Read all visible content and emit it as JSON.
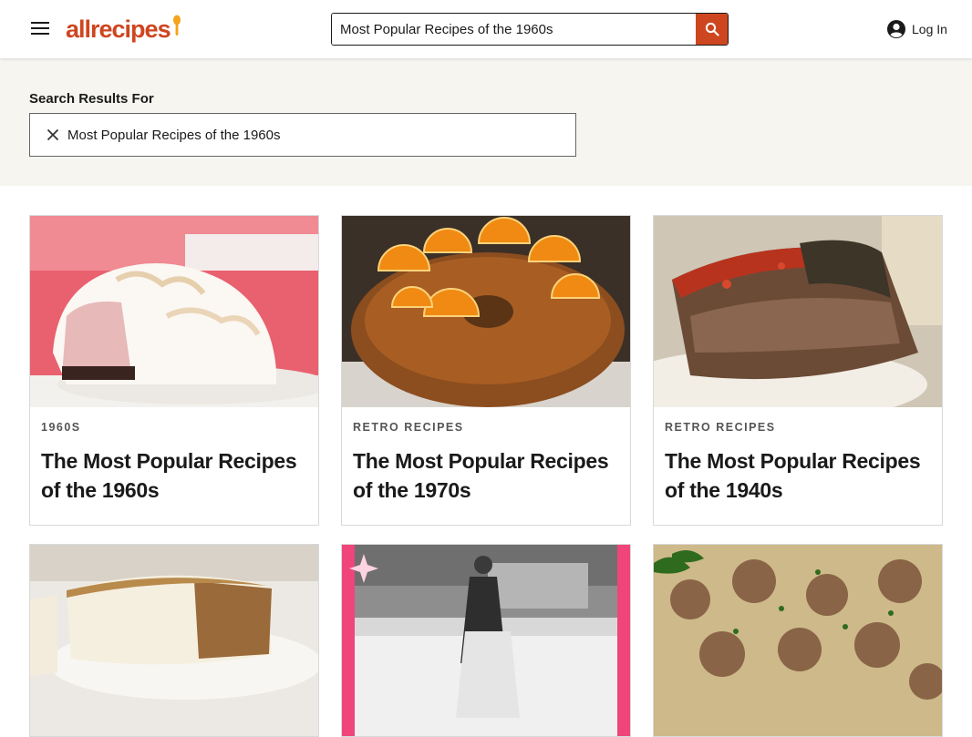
{
  "header": {
    "logo_text": "allrecipes",
    "search_value": "Most Popular Recipes of the 1960s",
    "login_label": "Log In",
    "brand_color": "#ce4620"
  },
  "results": {
    "title": "Search Results For",
    "query": "Most Popular Recipes of the 1960s"
  },
  "cards": [
    {
      "tag": "1960S",
      "title": "The Most Popular Recipes of the 1960s",
      "image": "baked-alaska-photo"
    },
    {
      "tag": "RETRO RECIPES",
      "title": "The Most Popular Recipes of the 1970s",
      "image": "orange-bundt-cake-photo"
    },
    {
      "tag": "RETRO RECIPES",
      "title": "The Most Popular Recipes of the 1940s",
      "image": "meatloaf-photo"
    },
    {
      "tag": "",
      "title": "",
      "image": "carrot-cake-photo"
    },
    {
      "tag": "",
      "title": "",
      "image": "retro-kitchen-photo"
    },
    {
      "tag": "",
      "title": "",
      "image": "swedish-meatballs-photo"
    }
  ],
  "icons": {
    "menu": "hamburger-menu-icon",
    "search": "search-icon",
    "account": "account-icon",
    "clear": "close-icon"
  }
}
